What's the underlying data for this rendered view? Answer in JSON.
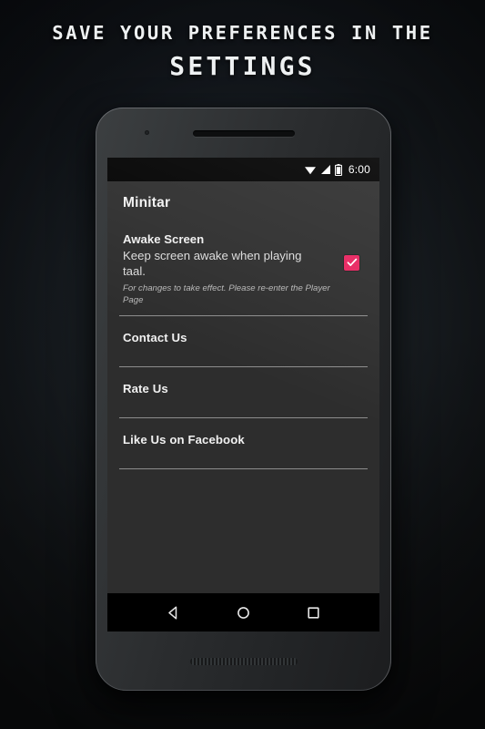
{
  "promo": {
    "headline_line1": "SAVE YOUR PREFERENCES IN THE",
    "headline_line2": "SETTINGS"
  },
  "device": {
    "statusbar": {
      "wifi_icon": "wifi-icon",
      "signal_icon": "signal-icon",
      "battery_icon": "battery-icon",
      "clock": "6:00"
    },
    "navbar": {
      "back_icon": "back-triangle-icon",
      "home_icon": "home-circle-icon",
      "recents_icon": "recents-square-icon"
    }
  },
  "app": {
    "title": "Minitar",
    "preference": {
      "title": "Awake Screen",
      "summary": "Keep screen awake when playing taal.",
      "note": "For changes to take effect. Please re-enter the Player Page",
      "checkbox_icon": "checkmark-icon",
      "checked": true
    },
    "items": [
      {
        "label": "Contact Us"
      },
      {
        "label": "Rate Us"
      },
      {
        "label": "Like Us on Facebook"
      }
    ]
  },
  "colors": {
    "accent": "#e8245f",
    "screen_bg": "#2d2d2d",
    "system_bar": "#000000",
    "divider": "#8d8d8d",
    "text_primary": "#f0f0f0",
    "promo_text": "#eef1f2"
  }
}
